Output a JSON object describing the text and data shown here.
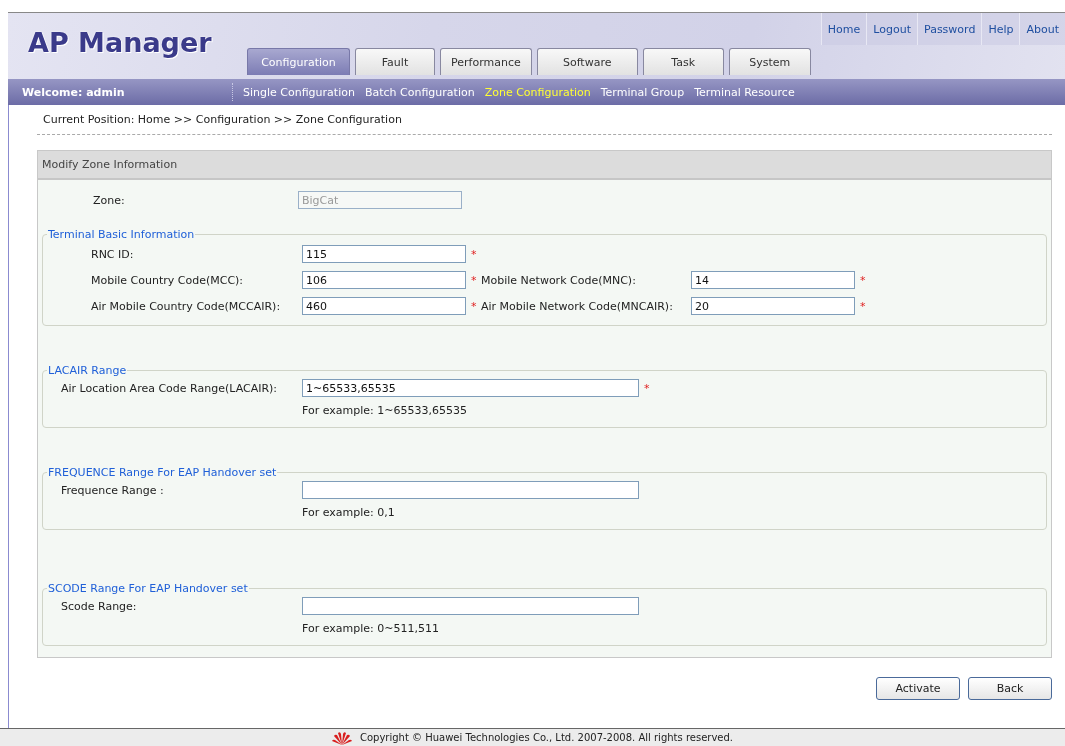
{
  "header": {
    "logo": "AP Manager",
    "top_links": [
      "Home",
      "Logout",
      "Password",
      "Help",
      "About"
    ],
    "tabs": [
      {
        "label": "Configuration",
        "selected": true
      },
      {
        "label": "Fault",
        "selected": false
      },
      {
        "label": "Performance",
        "selected": false
      },
      {
        "label": "Software",
        "selected": false
      },
      {
        "label": "Task",
        "selected": false
      },
      {
        "label": "System",
        "selected": false
      }
    ]
  },
  "nav_bar": {
    "welcome": "Welcome: admin",
    "items": [
      {
        "label": "Single Configuration",
        "selected": false
      },
      {
        "label": "Batch Configuration",
        "selected": false
      },
      {
        "label": "Zone Configuration",
        "selected": true
      },
      {
        "label": "Terminal Group",
        "selected": false
      },
      {
        "label": "Terminal Resource",
        "selected": false
      }
    ]
  },
  "breadcrumb": "Current Position: Home >> Configuration >> Zone Configuration",
  "panel": {
    "title": "Modify Zone Information",
    "zone": {
      "label": "Zone:",
      "value": "BigCat",
      "disabled": true
    },
    "fieldsets": [
      {
        "legend": "Terminal Basic Information",
        "kind": "grid",
        "rows": [
          [
            {
              "label": "RNC ID:",
              "value": "115",
              "mark": "*"
            }
          ],
          [
            {
              "label": "Mobile Country Code(MCC):",
              "value": "106",
              "mark": "*"
            },
            {
              "label": "Mobile Network Code(MNC):",
              "value": "14",
              "mark": "*"
            }
          ],
          [
            {
              "label": "Air Mobile Country Code(MCCAIR):",
              "value": "460",
              "mark": "*"
            },
            {
              "label": "Air Mobile Network Code(MNCAIR):",
              "value": "20",
              "mark": "*"
            }
          ]
        ]
      },
      {
        "legend": "LACAIR Range",
        "kind": "range",
        "rows": [
          [
            {
              "label": "Air Location Area Code Range(LACAIR):",
              "value": "1~65533,65535",
              "mark": "*"
            }
          ]
        ],
        "example": "For example: 1~65533,65535"
      },
      {
        "legend": "FREQUENCE Range For EAP Handover set",
        "kind": "range",
        "rows": [
          [
            {
              "label": "Frequence Range :"
            }
          ]
        ],
        "example": "For example: 0,1"
      },
      {
        "legend": "SCODE Range For EAP Handover set",
        "kind": "range",
        "rows": [
          [
            {
              "label": "Scode Range:"
            }
          ]
        ],
        "example": "For example: 0~511,511"
      }
    ]
  },
  "buttons": [
    "Activate",
    "Back"
  ],
  "footer": "Copyright © Huawei Technologies Co., Ltd. 2007-2008. All rights reserved."
}
